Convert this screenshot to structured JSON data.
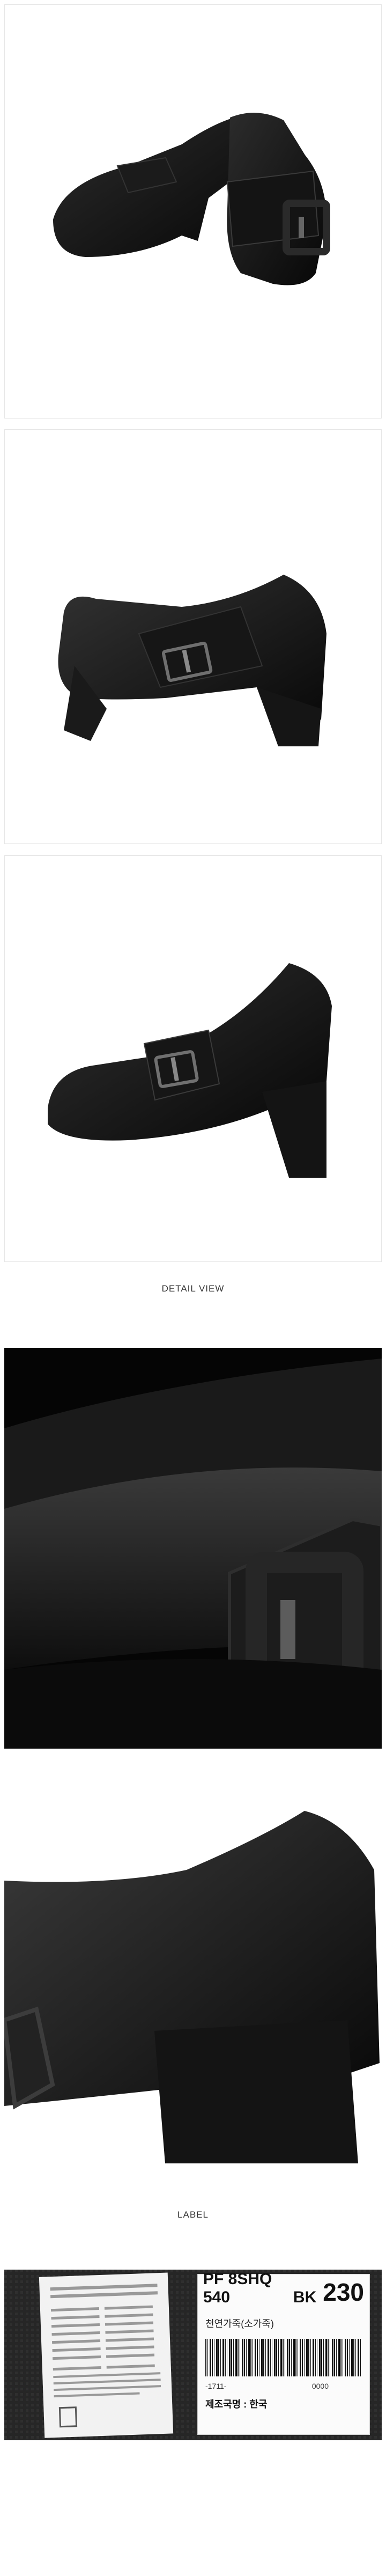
{
  "sections": {
    "detail_view_title": "DETAIL VIEW",
    "label_title": "LABEL"
  },
  "label": {
    "sticker_title": "PF 8SHQ 540 BK 230",
    "sticker_code": "PF 8SHQ 540",
    "sticker_color": "BK",
    "sticker_size": "230",
    "material": "천연가죽(소가죽)",
    "lot": "-1711-",
    "lot_number": "0000",
    "origin": "제조국명 : 한국"
  },
  "colors": {
    "leather": "#111111",
    "background": "#ffffff",
    "label_bg": "#2a2a2a"
  }
}
